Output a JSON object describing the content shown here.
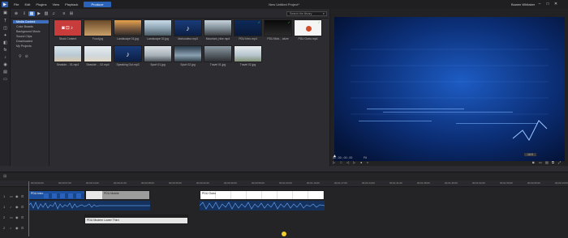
{
  "window": {
    "project_title": "New Untitled Project*",
    "user": "Bowen Whitaker",
    "mode_button": "Produce",
    "menu": [
      "File",
      "Edit",
      "Plugins",
      "View",
      "Playback"
    ],
    "window_buttons": [
      "–",
      "□",
      "✕"
    ]
  },
  "library": {
    "search_placeholder": "Search the library",
    "tree": [
      "Media Content",
      "Color Boards",
      "Background Music",
      "Sound Clips",
      "Downloaded",
      "My Projects"
    ],
    "items": [
      {
        "caption": "Stock Content",
        "kind": "stock"
      },
      {
        "caption": "Food.jpg",
        "kind": "food"
      },
      {
        "caption": "Landscape 01.jpg",
        "kind": "land1"
      },
      {
        "caption": "Landscape 02.jpg",
        "kind": "land2"
      },
      {
        "caption": "Mahoodeur.mp3",
        "kind": "music"
      },
      {
        "caption": "Mountain_hike.mp4",
        "kind": "mountain"
      },
      {
        "caption": "PDU Intro.mp4",
        "kind": "pduintro",
        "checked": true
      },
      {
        "caption": "PDU Mob... ature",
        "kind": "pdumob",
        "checked": true
      },
      {
        "caption": "PDU Outro.mp4",
        "kind": "pduoutro",
        "checked": true
      },
      {
        "caption": "Seaside... 01.mp4",
        "kind": "seaside1"
      },
      {
        "caption": "Seaside ... 02.mp4",
        "kind": "seaside2"
      },
      {
        "caption": "Speaking Out.mp3",
        "kind": "music"
      },
      {
        "caption": "Sport 01.jpg",
        "kind": "sport1"
      },
      {
        "caption": "Sport 02.jpg",
        "kind": "sport2"
      },
      {
        "caption": "Travel 01.jpg",
        "kind": "travel1"
      },
      {
        "caption": "Travel 02.jpg",
        "kind": "travel2"
      }
    ]
  },
  "preview": {
    "timecode": "00 ; 00 ; 00 ; 00",
    "quality": "Fit",
    "format": "16:9",
    "mode": "Movie"
  },
  "timeline": {
    "ruler": [
      "00;00;00;00",
      "00;00;07;00",
      "00;00;14;00",
      "00;00;21;00",
      "00;00;28;00",
      "00;00;35;00",
      "00;00;42;00",
      "00;00;49;00",
      "00;00;56;00",
      "00;01;03;00",
      "00;01;10;00",
      "00;01;17;00",
      "00;01;24;00",
      "00;01;31;00",
      "00;01;38;00",
      "00;01;45;00",
      "00;01;52;00",
      "00;01;59;00",
      "00;02;06;00",
      "00;02;13;00"
    ],
    "tracks": [
      "1",
      "1",
      "2",
      "2"
    ],
    "clips": {
      "intro": "PDU Intro",
      "mob": "PDU Mobile",
      "lower": "PDU Modern Lower Third",
      "outro": "PDU Outro"
    }
  },
  "colors": {
    "accent": "#3c6fc0",
    "playhead": "#e53a3a",
    "check": "#3ad15a"
  }
}
